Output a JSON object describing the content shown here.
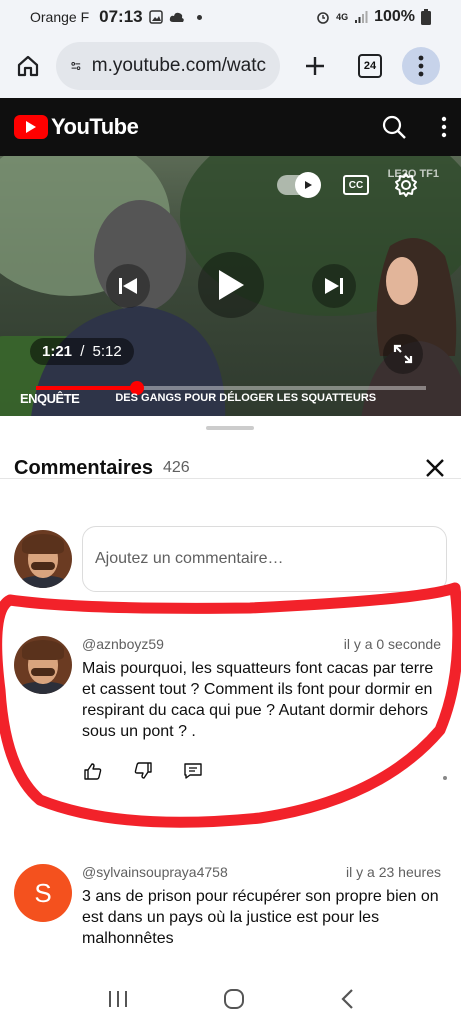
{
  "status_bar": {
    "carrier": "Orange F",
    "time": "07:13",
    "network": "4G",
    "battery": "100%"
  },
  "browser": {
    "url": "m.youtube.com/watc",
    "tab_count": "24"
  },
  "youtube": {
    "logo_text": "YouTube"
  },
  "video": {
    "current_time": "1:21",
    "separator": "/",
    "duration": "5:12",
    "progress_fraction": 0.26,
    "banner_show": "ENQUÊTE",
    "banner_text": "DES GANGS POUR DÉLOGER LES SQUATTEURS",
    "channel_mark": "LE2O TF1"
  },
  "comments_panel": {
    "title": "Commentaires",
    "count": "426",
    "add_placeholder": "Ajoutez un commentaire…",
    "comments": [
      {
        "author": "@aznboyz59",
        "when": "il y a 0 seconde",
        "text": "Mais pourquoi,  les squatteurs font cacas par terre et cassent tout ? Comment ils font pour dormir en respirant du caca qui pue ? Autant dormir dehors sous un pont ? ."
      },
      {
        "author": "@sylvainsoupraya4758",
        "when": "il y a 23 heures",
        "avatar_letter": "S",
        "text": "3 ans de prison pour récupérer son propre bien on est dans un pays où la justice est pour les malhonnêtes"
      }
    ]
  },
  "colors": {
    "yt_red": "#ff0000",
    "annotation_red": "#f2222a",
    "avatar_orange": "#f4511e"
  },
  "icons": [
    "home-icon",
    "site-settings-icon",
    "plus-icon",
    "tabs-icon",
    "more-vert-icon",
    "search-icon",
    "autoplay-toggle-icon",
    "captions-icon",
    "settings-gear-icon",
    "previous-icon",
    "play-icon",
    "next-icon",
    "fullscreen-icon",
    "close-icon",
    "like-icon",
    "dislike-icon",
    "reply-icon",
    "recents-icon",
    "home-nav-icon",
    "back-icon"
  ]
}
